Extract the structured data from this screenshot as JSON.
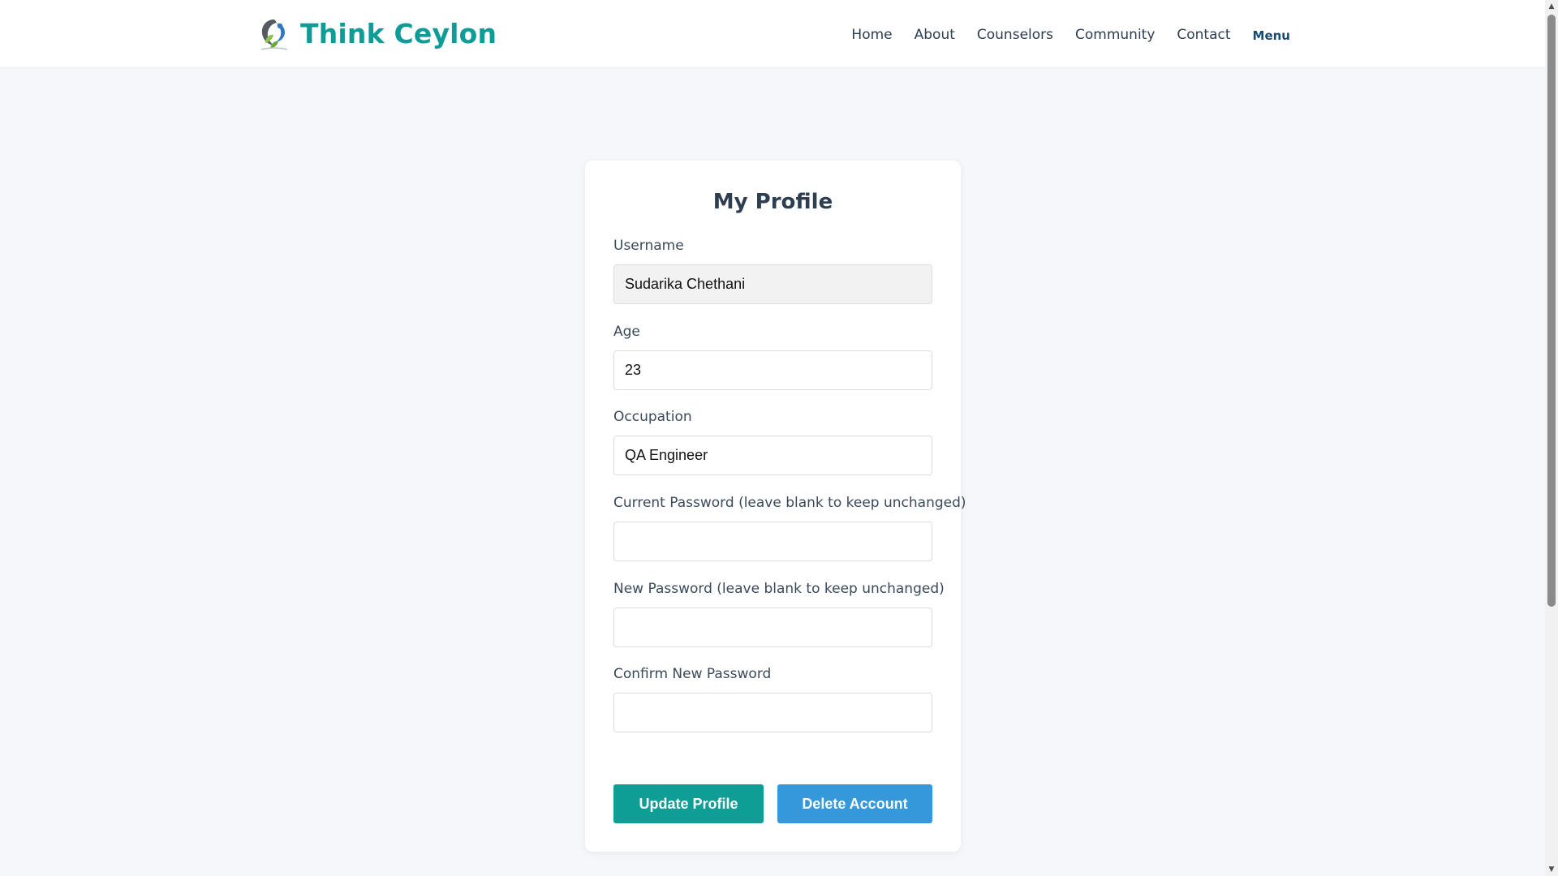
{
  "header": {
    "brand_name": "Think Ceylon",
    "logo_icon": "think-ceylon-logo-icon",
    "nav": [
      {
        "label": "Home"
      },
      {
        "label": "About"
      },
      {
        "label": "Counselors"
      },
      {
        "label": "Community"
      },
      {
        "label": "Contact"
      }
    ],
    "menu_label": "Menu"
  },
  "profile": {
    "title": "My Profile",
    "fields": {
      "username": {
        "label": "Username",
        "value": "Sudarika Chethani"
      },
      "age": {
        "label": "Age",
        "value": "23"
      },
      "occupation": {
        "label": "Occupation",
        "value": "QA Engineer"
      },
      "current_password": {
        "label": "Current Password (leave blank to keep unchanged)",
        "value": ""
      },
      "new_password": {
        "label": "New Password (leave blank to keep unchanged)",
        "value": ""
      },
      "confirm_password": {
        "label": "Confirm New Password",
        "value": ""
      }
    },
    "buttons": {
      "update": "Update Profile",
      "delete": "Delete Account"
    }
  },
  "colors": {
    "brand": "#0f9b96",
    "update_button": "#0f9e96",
    "delete_button": "#3498db",
    "menu_text": "#1a4b6e",
    "page_background": "#f5f7fa"
  },
  "scrollbar": {
    "up_icon": "scroll-up-arrow-icon",
    "down_icon": "scroll-down-arrow-icon"
  }
}
